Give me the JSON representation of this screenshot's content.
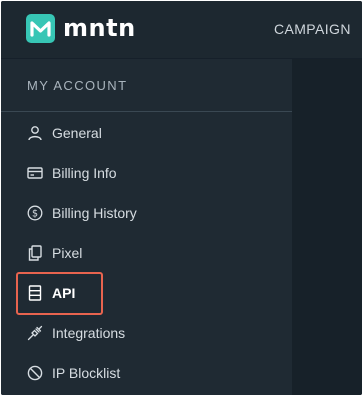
{
  "brand": {
    "name": "mntn"
  },
  "topnav": {
    "campaign_label": "CAMPAIGN"
  },
  "sidebar": {
    "section_title": "MY ACCOUNT",
    "items": [
      {
        "label": "General",
        "icon": "user-icon"
      },
      {
        "label": "Billing Info",
        "icon": "credit-card-icon"
      },
      {
        "label": "Billing History",
        "icon": "dollar-circle-icon"
      },
      {
        "label": "Pixel",
        "icon": "copy-icon"
      },
      {
        "label": "API",
        "icon": "server-icon",
        "active": true
      },
      {
        "label": "Integrations",
        "icon": "plug-icon"
      },
      {
        "label": "IP Blocklist",
        "icon": "block-icon"
      }
    ]
  },
  "colors": {
    "background": "#1f2a33",
    "accent": "#37c6b5",
    "highlight": "#e8644f"
  }
}
